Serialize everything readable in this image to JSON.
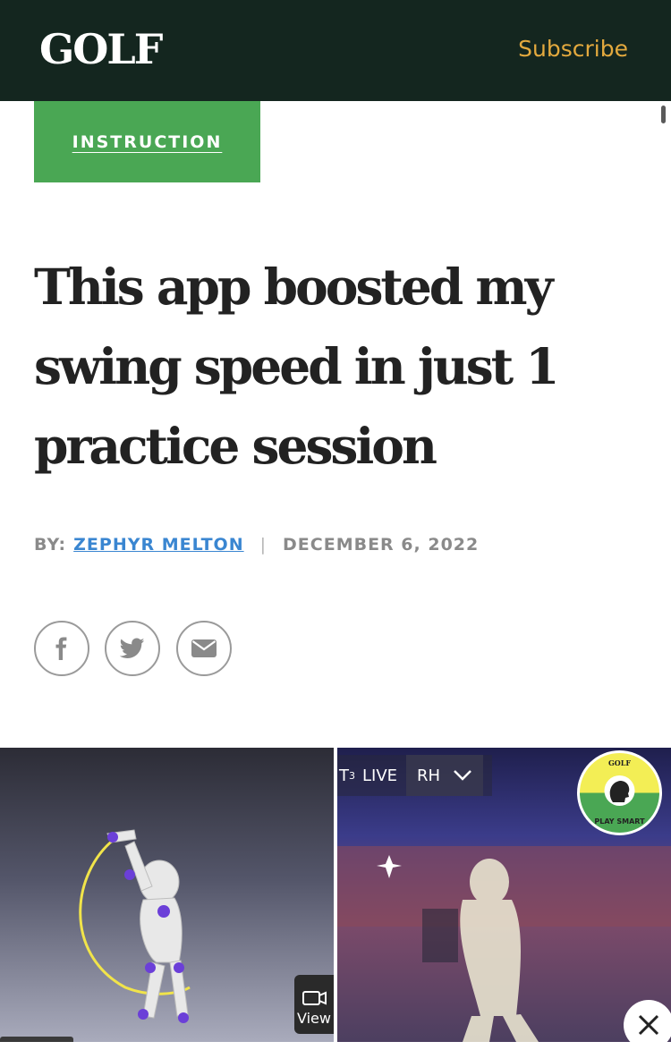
{
  "header": {
    "logo": "GOLF",
    "subscribe_label": "Subscribe"
  },
  "article": {
    "category": "INSTRUCTION",
    "headline": "This app boosted my swing speed in just 1 practice session",
    "byline_prefix": "BY:",
    "author": "ZEPHYR MELTON",
    "separator": "|",
    "date": "DECEMBER 6, 2022"
  },
  "share": {
    "icons": [
      "facebook-icon",
      "twitter-icon",
      "email-icon"
    ]
  },
  "hero": {
    "hud_left": "T",
    "hud_sub": "3",
    "hud_live": "LIVE",
    "hud_hand": "RH",
    "view_label": "View",
    "badge_top": "GOLF",
    "badge_text": "PLAY SMART"
  },
  "colors": {
    "header_bg": "#14261f",
    "subscribe": "#e3a93e",
    "category_bg": "#4aa754",
    "author_link": "#3a86d1"
  }
}
